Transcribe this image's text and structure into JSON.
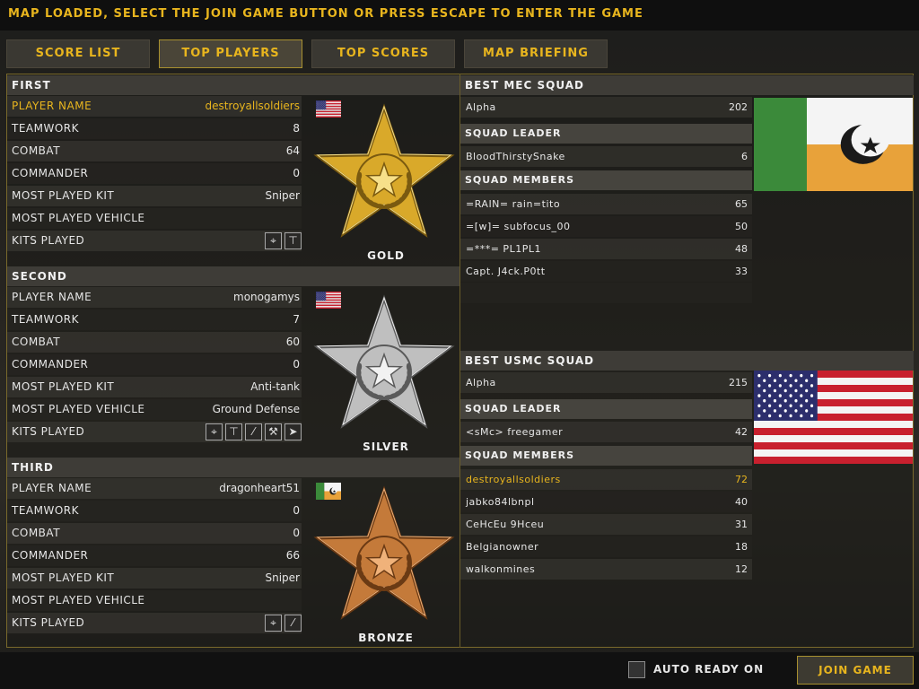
{
  "banner": "MAP LOADED, SELECT THE JOIN GAME BUTTON OR PRESS ESCAPE TO ENTER THE GAME",
  "tabs": [
    {
      "label": "SCORE LIST",
      "active": false
    },
    {
      "label": "TOP PLAYERS",
      "active": true
    },
    {
      "label": "TOP SCORES",
      "active": false
    },
    {
      "label": "MAP BRIEFING",
      "active": false
    }
  ],
  "places": [
    {
      "heading": "FIRST",
      "medal": "GOLD",
      "flag": "usmc",
      "stats": [
        {
          "label": "PLAYER NAME",
          "value": "destroyallsoldiers"
        },
        {
          "label": "TEAMWORK",
          "value": "8"
        },
        {
          "label": "COMBAT",
          "value": "64"
        },
        {
          "label": "COMMANDER",
          "value": "0"
        },
        {
          "label": "MOST PLAYED KIT",
          "value": "Sniper"
        },
        {
          "label": "MOST PLAYED VEHICLE",
          "value": ""
        },
        {
          "label": "KITS PLAYED",
          "value": ""
        }
      ],
      "kits": [
        "sniper-kit-icon",
        "support-kit-icon"
      ]
    },
    {
      "heading": "SECOND",
      "medal": "SILVER",
      "flag": "usmc",
      "stats": [
        {
          "label": "PLAYER NAME",
          "value": "monogamys"
        },
        {
          "label": "TEAMWORK",
          "value": "7"
        },
        {
          "label": "COMBAT",
          "value": "60"
        },
        {
          "label": "COMMANDER",
          "value": "0"
        },
        {
          "label": "MOST PLAYED KIT",
          "value": "Anti-tank"
        },
        {
          "label": "MOST PLAYED VEHICLE",
          "value": "Ground Defense"
        },
        {
          "label": "KITS PLAYED",
          "value": ""
        }
      ],
      "kits": [
        "sniper-kit-icon",
        "support-kit-icon",
        "assault-kit-icon",
        "engineer-kit-icon",
        "anti-tank-kit-icon"
      ]
    },
    {
      "heading": "THIRD",
      "medal": "BRONZE",
      "flag": "mec",
      "stats": [
        {
          "label": "PLAYER NAME",
          "value": "dragonheart51"
        },
        {
          "label": "TEAMWORK",
          "value": "0"
        },
        {
          "label": "COMBAT",
          "value": "0"
        },
        {
          "label": "COMMANDER",
          "value": "66"
        },
        {
          "label": "MOST PLAYED KIT",
          "value": "Sniper"
        },
        {
          "label": "MOST PLAYED VEHICLE",
          "value": ""
        },
        {
          "label": "KITS PLAYED",
          "value": ""
        }
      ],
      "kits": [
        "sniper-kit-icon",
        "assault-kit-icon"
      ]
    }
  ],
  "mec": {
    "heading": "BEST MEC SQUAD",
    "squad": {
      "name": "Alpha",
      "score": "202"
    },
    "leader_heading": "SQUAD LEADER",
    "leader": {
      "name": "BloodThirstySnake",
      "score": "6"
    },
    "members_heading": "SQUAD MEMBERS",
    "members": [
      {
        "name": "=RAIN= rain=tito",
        "score": "65"
      },
      {
        "name": "=[w]= subfocus_00",
        "score": "50"
      },
      {
        "name": "=***= PL1PL1",
        "score": "48"
      },
      {
        "name": "Capt. J4ck.P0tt",
        "score": "33"
      }
    ]
  },
  "usmc": {
    "heading": "BEST USMC SQUAD",
    "squad": {
      "name": "Alpha",
      "score": "215"
    },
    "leader_heading": "SQUAD LEADER",
    "leader": {
      "name": "<sMc> freegamer",
      "score": "42"
    },
    "members_heading": "SQUAD MEMBERS",
    "members": [
      {
        "name": "destroyallsoldiers",
        "score": "72",
        "highlight": true
      },
      {
        "name": "jabko84lbnpl",
        "score": "40"
      },
      {
        "name": "CeHcEu 9Hceu",
        "score": "31"
      },
      {
        "name": "Belgianowner",
        "score": "18"
      },
      {
        "name": "walkonmines",
        "score": "12"
      }
    ]
  },
  "footer": {
    "auto_ready": "AUTO READY ON",
    "join": "JOIN GAME"
  },
  "colors": {
    "accent": "#e8b51e",
    "gold": "#d4a72c",
    "silver": "#c9c9c9",
    "bronze": "#c47a3a"
  }
}
